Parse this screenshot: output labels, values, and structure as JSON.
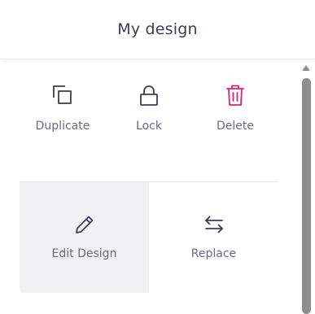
{
  "header": {
    "title": "My design"
  },
  "actions": {
    "duplicate": {
      "label": "Duplicate",
      "icon": "duplicate-icon"
    },
    "lock": {
      "label": "Lock",
      "icon": "lock-icon"
    },
    "delete": {
      "label": "Delete",
      "icon": "trash-icon",
      "color": "#d6246e"
    }
  },
  "tiles": {
    "edit": {
      "label": "Edit Design",
      "icon": "pencil-icon"
    },
    "replace": {
      "label": "Replace",
      "icon": "swap-arrows-icon"
    }
  },
  "colors": {
    "icon": "#3f3a55",
    "label": "#6c6a7d",
    "delete": "#d6246e",
    "tile_bg": "#f0f0f3",
    "scrollbar": "#8e8e8e"
  }
}
